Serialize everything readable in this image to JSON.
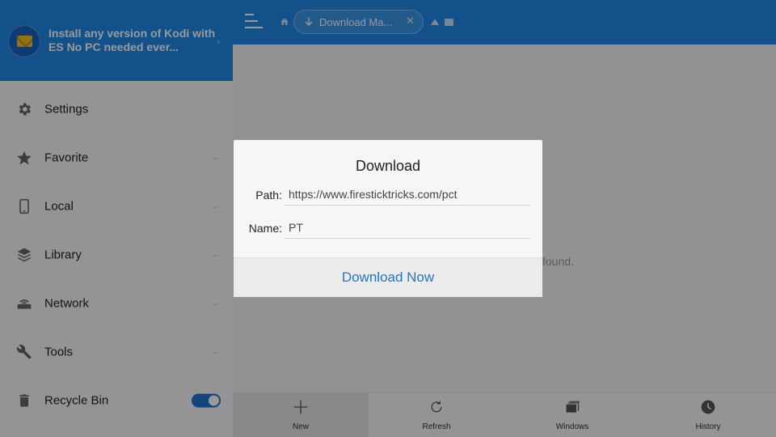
{
  "colors": {
    "brand_blue": "#1e88e5",
    "link_blue": "#2277c6",
    "toggle_on": "#1976d2"
  },
  "promo": {
    "text": "Install any version of Kodi with ES No PC needed ever...",
    "icon": "mail-icon"
  },
  "sidebar": {
    "items": [
      {
        "label": "Settings",
        "icon": "gear-icon"
      },
      {
        "label": "Favorite",
        "icon": "star-icon"
      },
      {
        "label": "Local",
        "icon": "phone-icon"
      },
      {
        "label": "Library",
        "icon": "layers-icon"
      },
      {
        "label": "Network",
        "icon": "router-icon"
      },
      {
        "label": "Tools",
        "icon": "wrench-icon"
      },
      {
        "label": "Recycle Bin",
        "icon": "trash-icon",
        "toggle_on": true
      }
    ]
  },
  "topbar": {
    "breadcrumb": "Download Ma..."
  },
  "content": {
    "empty_partial": "found."
  },
  "bottombar": {
    "items": [
      {
        "label": "New",
        "icon": "plus-icon"
      },
      {
        "label": "Refresh",
        "icon": "refresh-icon"
      },
      {
        "label": "Windows",
        "icon": "windows-icon"
      },
      {
        "label": "History",
        "icon": "clock-icon"
      }
    ]
  },
  "dialog": {
    "title": "Download",
    "path_label": "Path:",
    "path_value": "https://www.firesticktricks.com/pct",
    "name_label": "Name:",
    "name_value": "PT",
    "button_label": "Download Now"
  }
}
